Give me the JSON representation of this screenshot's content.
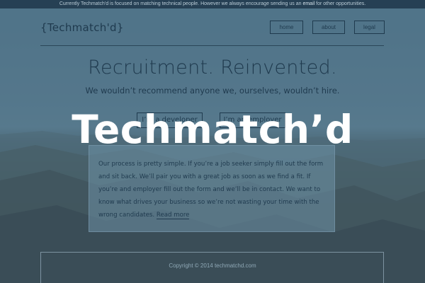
{
  "notice": {
    "before": "Currently Techmatch'd is focused on matching technical people. However we always encourage sending us an",
    "link": "email",
    "after": "for other opportunities."
  },
  "header": {
    "logo": "{Techmatch'd}",
    "nav": {
      "home": "home",
      "about": "about",
      "legal": "legal"
    }
  },
  "hero": {
    "title": "Recruitment. Reinvented.",
    "subtitle": "We wouldn’t recommend anyone we, ourselves, wouldn’t hire.",
    "developer_button": "I’m a developer",
    "employer_button": "I’m an employer"
  },
  "info": {
    "text": "Our process is pretty simple. If you’re a job seeker simply fill out the form and sit back. We’ll pair you with a great job as soon as we find a fit. If you’re and employer fill out the form and we’ll be in contact. We want to know what drives your business so we’re not wasting your time with the wrong candidates.",
    "read_more": "Read more"
  },
  "overlay": {
    "wordmark": "Techmatch’d"
  },
  "footer": {
    "copyright": "Copyright © 2014 techmatchd.com"
  },
  "colors": {
    "text_dark": "#1f3a4e",
    "overlay_tint": "#28506e",
    "wordmark": "#ffffff"
  }
}
